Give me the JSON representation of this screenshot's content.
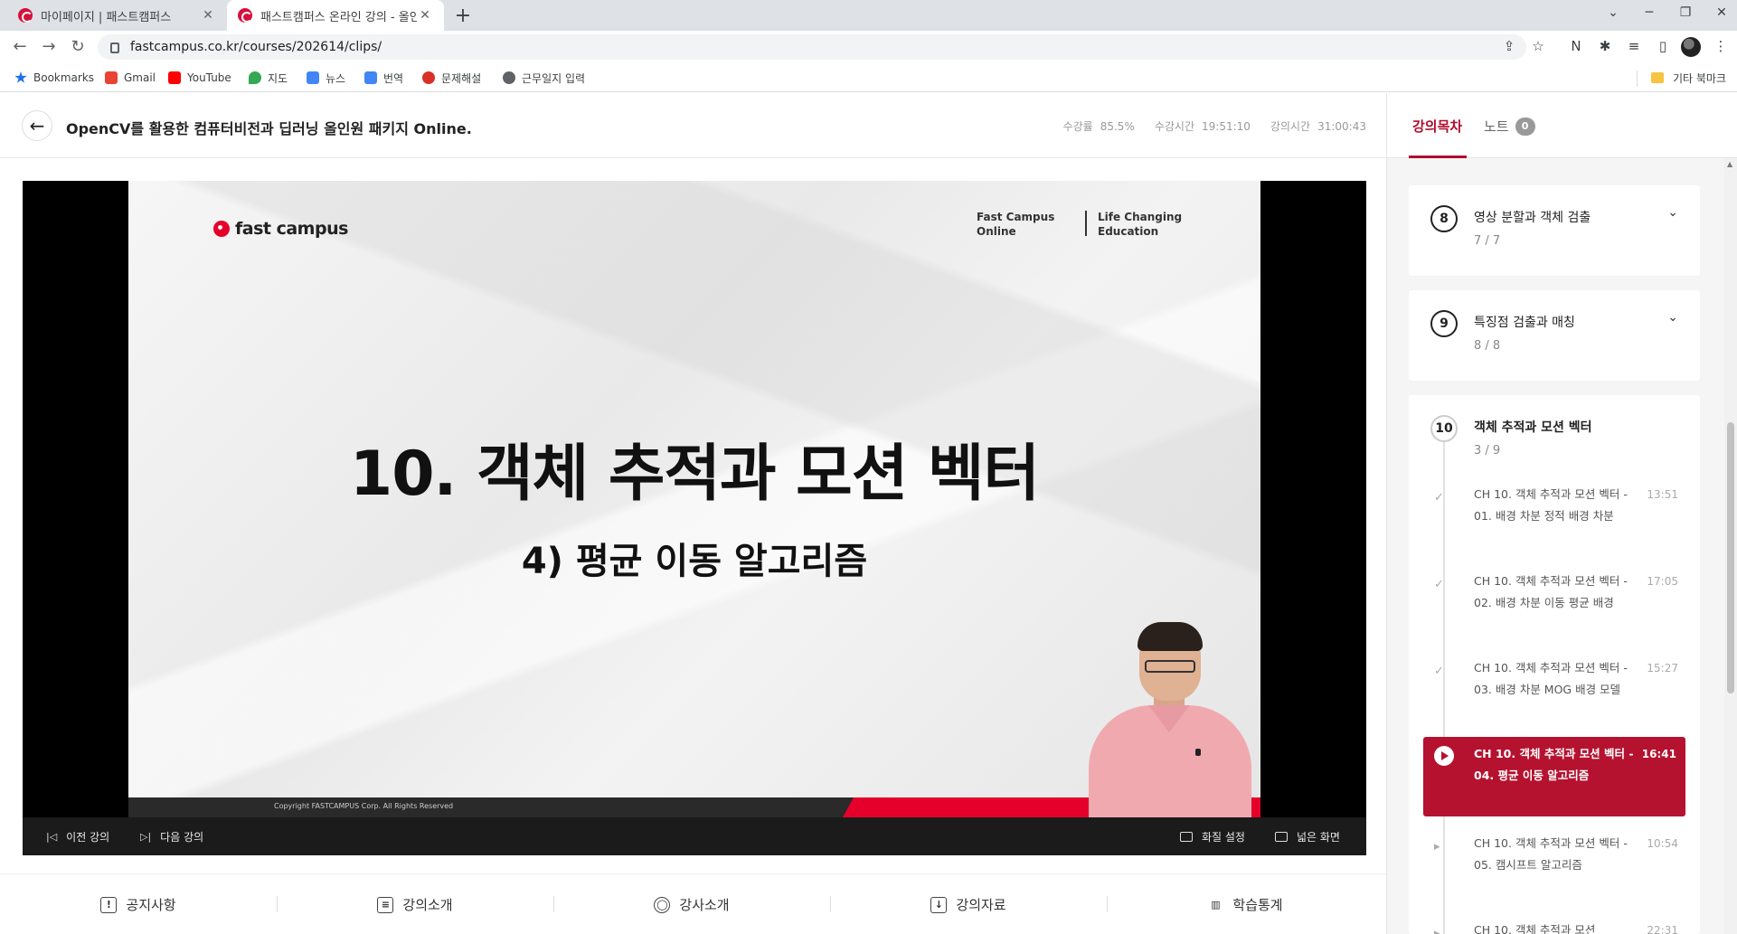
{
  "browser": {
    "tabs": [
      {
        "title": "마이페이지 | 패스트캠퍼스"
      },
      {
        "title": "패스트캠퍼스 온라인 강의 - 올인"
      }
    ],
    "url": "fastcampus.co.kr/courses/202614/clips/",
    "bookmarks": [
      {
        "label": "Bookmarks",
        "color": "#1a73e8"
      },
      {
        "label": "Gmail",
        "color": "#ea4335"
      },
      {
        "label": "YouTube",
        "color": "#ff0000"
      },
      {
        "label": "지도",
        "color": "#34a853"
      },
      {
        "label": "뉴스",
        "color": "#4285f4"
      },
      {
        "label": "번역",
        "color": "#4285f4"
      },
      {
        "label": "문제해설",
        "color": "#d93025"
      },
      {
        "label": "근무일지 입력",
        "color": "#5f6368"
      }
    ],
    "other_bookmarks": "기타 북마크"
  },
  "header": {
    "title": "OpenCV를 활용한 컴퓨터비전과 딥러닝 올인원 패키지 Online.",
    "stats": [
      {
        "label": "수강률",
        "value": "85.5%"
      },
      {
        "label": "수강시간",
        "value": "19:51:10"
      },
      {
        "label": "강의시간",
        "value": "31:00:43"
      }
    ]
  },
  "slide": {
    "logo": "fast campus",
    "tagline_left": [
      "Fast Campus",
      "Online"
    ],
    "tagline_right": [
      "Life Changing",
      "Education"
    ],
    "title": "10. 객체 추적과 모션 벡터",
    "subtitle": "4) 평균 이동 알고리즘",
    "copyright": "Copyright FASTCAMPUS Corp. All Rights Reserved"
  },
  "player_controls": {
    "prev": "이전 강의",
    "next": "다음 강의",
    "quality": "화질 설정",
    "wide": "넓은 화면"
  },
  "bottom_nav": [
    {
      "label": "공지사항",
      "icon": "!"
    },
    {
      "label": "강의소개",
      "icon": "≡"
    },
    {
      "label": "강사소개",
      "icon": "◯"
    },
    {
      "label": "강의자료",
      "icon": "↓"
    },
    {
      "label": "학습통계",
      "icon": "▥"
    }
  ],
  "sidebar": {
    "tabs": [
      {
        "label": "강의목차"
      },
      {
        "label": "노트",
        "badge": "0"
      }
    ],
    "sections": [
      {
        "num": "8",
        "title": "영상 분할과 객체 검출",
        "count": "7 / 7"
      },
      {
        "num": "9",
        "title": "특징점 검출과 매칭",
        "count": "8 / 8"
      },
      {
        "num": "10",
        "title": "객체 추적과 모션 벡터",
        "count": "3 / 9"
      }
    ],
    "lessons": [
      {
        "title": "CH 10. 객체 추적과 모션 벡터 - 01. 배경 차분 정적 배경 차분",
        "time": "13:51",
        "mark": "✓"
      },
      {
        "title": "CH 10. 객체 추적과 모션 벡터 - 02. 배경 차분 이동 평균 배경",
        "time": "17:05",
        "mark": "✓"
      },
      {
        "title": "CH 10. 객체 추적과 모션 벡터 - 03. 배경 차분 MOG 배경 모델",
        "time": "15:27",
        "mark": "✓"
      },
      {
        "title": "CH 10. 객체 추적과 모션 벡터 - 04. 평균 이동 알고리즘",
        "time": "16:41",
        "mark": ""
      },
      {
        "title": "CH 10. 객체 추적과 모션 벡터 - 05. 캠시프트 알고리즘",
        "time": "10:54",
        "mark": "▸"
      },
      {
        "title": "CH 10. 객체 추적과 모션",
        "time": "22:31",
        "mark": "▸"
      }
    ]
  }
}
